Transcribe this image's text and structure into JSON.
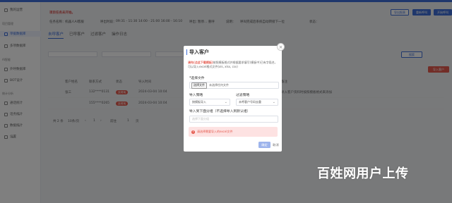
{
  "sidebar": {
    "title": "我的运营",
    "section_project": "项目管理",
    "item_active": "单据数据库",
    "item_2": "多项数据库",
    "section_2": "AI智能",
    "item_3": "外呼数据库",
    "item_4": "BOT设计",
    "section_3": "统计分析",
    "item_5": "通话统计",
    "item_6": "话务统计",
    "item_7": "数据统计",
    "item_8": "设置"
  },
  "page": {
    "warning": "项目任务未开始。",
    "info_labels": [
      "任务名称：",
      "机器人AI客服",
      "呼出时段：",
      "09:31 - 11:30 14:00 - 21:00 16:00 - 16:10",
      "呼出：",
      "暂停... 重呼",
      "说明：",
      "呼叫完成后系统自动转接下一位",
      "状态："
    ],
    "top_buttons": [
      "导出报表",
      "重新呼叫",
      "开始呼叫"
    ],
    "tabs": [
      "未呼客户",
      "已呼客户",
      "过滤客户",
      "操作日志"
    ],
    "search_button": "搜索",
    "import_button": "导入客户"
  },
  "table": {
    "headers": [
      "客户姓名",
      "联系方式",
      "状态",
      "导入时间",
      "备注"
    ],
    "rows": [
      {
        "name": "张三",
        "phone": "132****0131",
        "status": "未呼叫",
        "time": "2024-03-04 10:04",
        "note": "导入客户资料时按照模板格式来添加"
      },
      {
        "name": "",
        "phone": "155****0265",
        "status": "未呼叫",
        "time": "2024-03-04 10:04",
        "note": ""
      }
    ],
    "pager": {
      "total": "共 2 条",
      "page_size": "10条/页",
      "goto": "前往",
      "page": "1",
      "unit": "页"
    }
  },
  "modal": {
    "title": "导入客户",
    "notice_prefix": "请先(点此下载模板)",
    "notice_rest": "按照模板格式并根据要求填写(模板中)已有字段名，可以导入excel格式文件(xls, xlsx, csv)",
    "file_label": "*选择文件",
    "file_button": "选择文件",
    "file_text": "未选择任何文件",
    "strategy_label": "导入策略",
    "strategy_value": "按模板导入",
    "filter_label": "过滤策略",
    "filter_value": "未呼客户号码去重",
    "group_label": "导入到下面分组（不选择导入到默认组）",
    "group_placeholder": "选择下面分组",
    "error_text": "请选择需要导入的excel文件",
    "confirm": "确定",
    "cancel": "取消"
  },
  "watermark": "百姓网用户上传",
  "colors": {
    "primary": "#3e6fd8",
    "danger": "#e55a4e",
    "error_bg": "#fde2e2"
  }
}
